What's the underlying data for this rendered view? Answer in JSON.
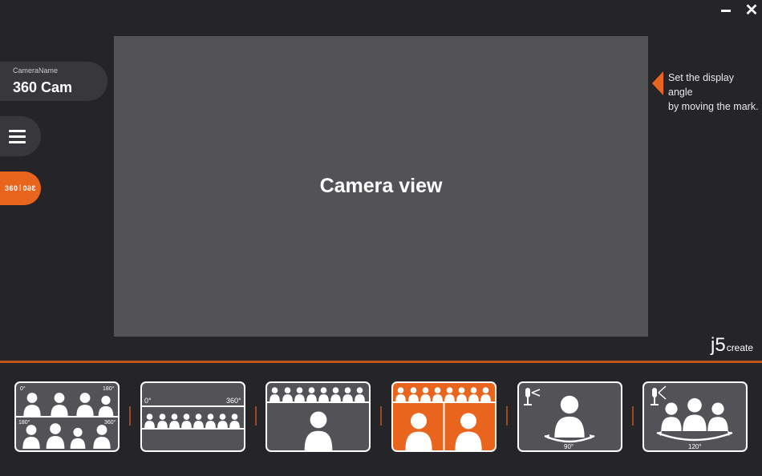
{
  "window": {
    "minimize_symbol": "–",
    "close_symbol": "✕"
  },
  "camera": {
    "label": "CameraName",
    "name": "360 Cam"
  },
  "mode_button": {
    "text_left": "360",
    "text_right": "360"
  },
  "viewport": {
    "text": "Camera view"
  },
  "hint": {
    "line1": "Set the display angle",
    "line2": "by moving the mark."
  },
  "brand": {
    "j5": "j5",
    "create": "create"
  },
  "layouts": [
    {
      "name": "quad-view",
      "labels": [
        "0°",
        "180°",
        "180°",
        "360°"
      ]
    },
    {
      "name": "panorama-split",
      "labels": [
        "0°",
        "360°"
      ]
    },
    {
      "name": "panorama-plus-single"
    },
    {
      "name": "panorama-plus-dual",
      "active": true
    },
    {
      "name": "single-angle",
      "angle_label": "90°"
    },
    {
      "name": "wide-angle",
      "angle_label": "120°"
    }
  ],
  "colors": {
    "accent": "#e9651d",
    "background": "#252429",
    "panel": "#38373c",
    "viewport": "#535257"
  }
}
